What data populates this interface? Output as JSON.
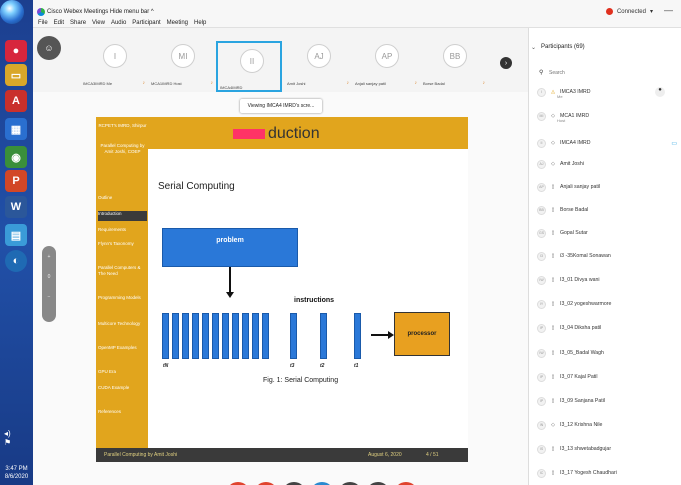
{
  "window": {
    "app_title": "Cisco Webex Meetings   Hide menu bar ^",
    "menu": [
      "File",
      "Edit",
      "Share",
      "View",
      "Audio",
      "Participant",
      "Meeting",
      "Help"
    ],
    "status": "Connected",
    "minimize": "—"
  },
  "taskbar": {
    "clock_time": "3:47 PM",
    "clock_date": "8/6/2020",
    "tray_icons": [
      "volume-icon",
      "network-icon",
      "flag-icon"
    ]
  },
  "filmstrip": {
    "self_initial": "☺",
    "tiles": [
      {
        "initials": "I",
        "label": "IMCA3IMRD Me"
      },
      {
        "initials": "MI",
        "label": "MCA1IMRD Host"
      },
      {
        "initials": "II",
        "label": "IMCA4IMRD"
      },
      {
        "initials": "AJ",
        "label": "Amit Joshi"
      },
      {
        "initials": "AP",
        "label": "Anjali sanjay patil"
      },
      {
        "initials": "BB",
        "label": "Borse Badal"
      }
    ],
    "next": "›"
  },
  "viewing_banner": "Viewing IMCA4 IMRD's scre...",
  "slide": {
    "sidebar_top": "RCPET's IMRD, Shirpur",
    "sidebar_sub": "Parallel Computing by Amit Joshi, COEP",
    "nav": [
      "Outline",
      "Introduction",
      "Requirements",
      "Flynn's Taxonomy",
      "Parallel Computers & The Need",
      "Programming Models",
      "Multicore Technology",
      "OpenMP Examples",
      "GPU Era",
      "CUDA Example",
      "References"
    ],
    "current_nav": "Introduction",
    "title": "duction",
    "section_title": "Serial Computing",
    "problem_label": "problem",
    "instructions_label": "instructions",
    "t_labels": [
      "tN",
      "t3",
      "t2",
      "t1"
    ],
    "processor_label": "processor",
    "caption": "Fig. 1: Serial Computing",
    "footer_left": "Parallel Computing by Amit Joshi",
    "footer_date": "August 6, 2020",
    "footer_page": "4 / 51"
  },
  "zoom": {
    "plus": "+",
    "zero": "0",
    "minus": "−"
  },
  "controls": [
    {
      "name": "mute-button",
      "color": "#e0442e",
      "glyph": "🎙"
    },
    {
      "name": "video-button",
      "color": "#e0442e",
      "glyph": "▭"
    },
    {
      "name": "share-button",
      "color": "#444444",
      "glyph": "⇪"
    },
    {
      "name": "participants-button",
      "color": "#2a8ad0",
      "glyph": "👤"
    },
    {
      "name": "chat-button",
      "color": "#444444",
      "glyph": "💬"
    },
    {
      "name": "more-button",
      "color": "#444444",
      "glyph": "…"
    },
    {
      "name": "leave-button",
      "color": "#e0442e",
      "glyph": "✕"
    }
  ],
  "participants": {
    "title": "Participants (69)",
    "search_placeholder": "Search",
    "list": [
      {
        "initials": "I",
        "name": "IMCA3 IMRD",
        "sub": "Me"
      },
      {
        "initials": "MI",
        "name": "MCA1 IMRD",
        "sub": "Host"
      },
      {
        "initials": "II",
        "name": "IMCA4 IMRD",
        "sub": ""
      },
      {
        "initials": "AJ",
        "name": "Amit Joshi",
        "sub": ""
      },
      {
        "initials": "AP",
        "name": "Anjali sanjay patil",
        "sub": ""
      },
      {
        "initials": "BB",
        "name": "Borse Badal",
        "sub": ""
      },
      {
        "initials": "GS",
        "name": "Gopal Sutar",
        "sub": ""
      },
      {
        "initials": "I3",
        "name": "i3 -35Komal Sonawan",
        "sub": ""
      },
      {
        "initials": "IW",
        "name": "I3_01 Divya wani",
        "sub": ""
      },
      {
        "initials": "IY",
        "name": "I3_02 yogeshwarmore",
        "sub": ""
      },
      {
        "initials": "IP",
        "name": "I3_04 Diksha patil",
        "sub": ""
      },
      {
        "initials": "IW",
        "name": "I3_05_Badal Wagh",
        "sub": ""
      },
      {
        "initials": "IP",
        "name": "I3_07 Kajal Patil",
        "sub": ""
      },
      {
        "initials": "IP",
        "name": "I3_09 Sanjana Patil",
        "sub": ""
      },
      {
        "initials": "IN",
        "name": "I3_12 Krishna Nile",
        "sub": ""
      },
      {
        "initials": "IS",
        "name": "I3_13 shwetabadgujar",
        "sub": ""
      },
      {
        "initials": "IC",
        "name": "I3_17 Yogesh Chaudhari",
        "sub": ""
      }
    ]
  }
}
